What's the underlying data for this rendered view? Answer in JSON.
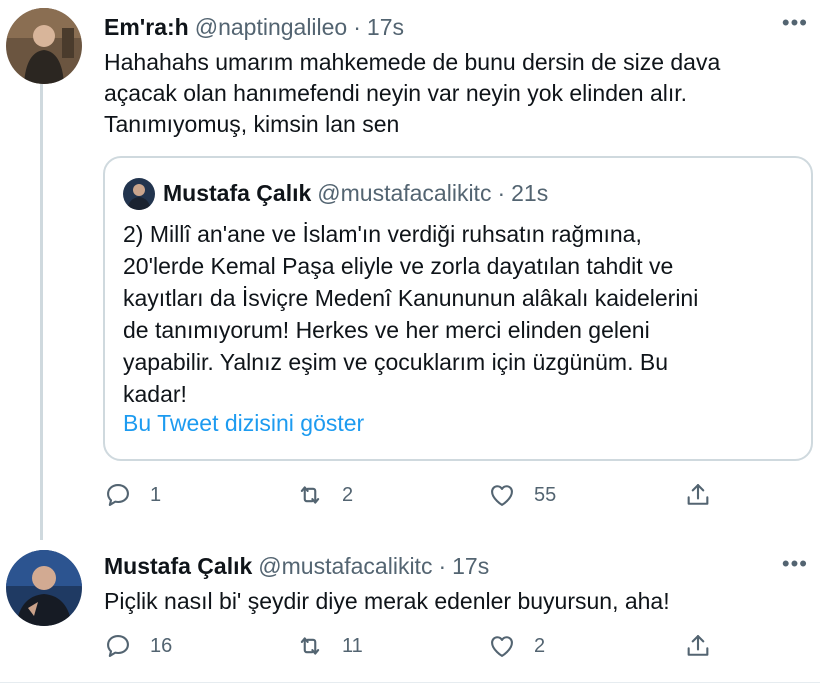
{
  "tweets": [
    {
      "name": "Em'ra:h",
      "handle": "@naptingalileo",
      "separator": "·",
      "time": "17s",
      "more": "•••",
      "text_lines": [
        "Hahahahs umarım mahkemede de bunu dersin de size dava",
        "açacak olan hanımefendi neyin var neyin yok elinden alır.",
        "Tanımıyomuş, kimsin lan sen"
      ],
      "quote": {
        "name": "Mustafa Çalık",
        "handle": "@mustafacalikitc",
        "separator": "·",
        "time": "21s",
        "text_lines": [
          "2) Millî an'ane ve İslam'ın verdiği ruhsatın rağmına,",
          "20'lerde Kemal Paşa eliyle ve zorla dayatılan tahdit ve",
          "kayıtları da İsviçre Medenî Kanununun alâkalı kaidelerini",
          "de tanımıyorum! Herkes ve her merci elinden geleni",
          "yapabilir. Yalnız eşim ve çocuklarım için üzgünüm. Bu",
          "kadar!"
        ],
        "link": "Bu Tweet dizisini göster"
      },
      "actions": {
        "reply": "1",
        "retweet": "2",
        "like": "55"
      }
    },
    {
      "name": "Mustafa Çalık",
      "handle": "@mustafacalikitc",
      "separator": "·",
      "time": "17s",
      "more": "•••",
      "text_lines": [
        "Piçlik nasıl bi' şeydir diye merak edenler buyursun, aha!"
      ],
      "actions": {
        "reply": "16",
        "retweet": "11",
        "like": "2"
      }
    }
  ],
  "colors": {
    "text": "#0f1419",
    "muted": "#536471",
    "link": "#1d9bf0",
    "border": "#cfd9de"
  },
  "icons": [
    "reply-icon",
    "retweet-icon",
    "like-icon",
    "share-icon",
    "more-icon"
  ]
}
